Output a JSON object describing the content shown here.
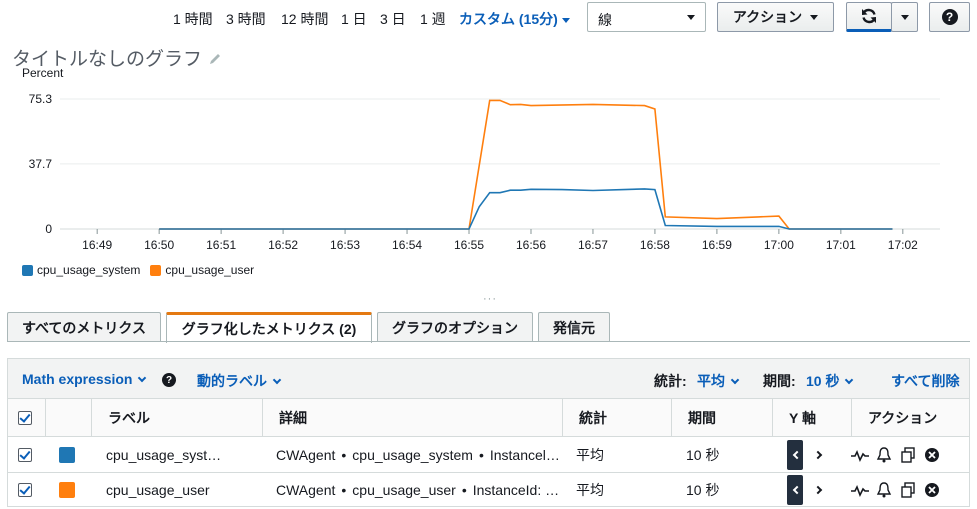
{
  "time_ranges": [
    "1 時間",
    "3 時間",
    "12 時間",
    "1 日",
    "3 日",
    "1 週"
  ],
  "custom_range": "カスタム (15分)",
  "view_select": {
    "value": "線"
  },
  "buttons": {
    "actions": "アクション"
  },
  "chart": {
    "title": "タイトルなしのグラフ",
    "unit_label": "Percent"
  },
  "chart_data": {
    "type": "line",
    "ylabel": "Percent",
    "yticks": [
      0,
      37.7,
      75.3
    ],
    "ylim": [
      0,
      75.3
    ],
    "xticks": [
      "16:49",
      "16:50",
      "16:51",
      "16:52",
      "16:53",
      "16:54",
      "16:55",
      "16:56",
      "16:57",
      "16:58",
      "16:59",
      "17:00",
      "17:01",
      "17:02"
    ],
    "grid": true,
    "legend_position": "bottom-left",
    "series": [
      {
        "name": "cpu_usage_system",
        "color": "#1f77b4",
        "points": [
          [
            "16:50",
            0
          ],
          [
            "16:55",
            0
          ],
          [
            "16:55:10",
            13
          ],
          [
            "16:55:20",
            21
          ],
          [
            "16:55:30",
            21
          ],
          [
            "16:55:40",
            22.5
          ],
          [
            "16:55:50",
            22.5
          ],
          [
            "16:56",
            23
          ],
          [
            "16:56:30",
            22.8
          ],
          [
            "16:57",
            22.3
          ],
          [
            "16:57:30",
            22.8
          ],
          [
            "16:57:50",
            23.2
          ],
          [
            "16:58",
            22.8
          ],
          [
            "16:58:10",
            2
          ],
          [
            "16:59",
            1.5
          ],
          [
            "16:59:40",
            1.5
          ],
          [
            "17:00",
            1.5
          ],
          [
            "17:00:10",
            0
          ],
          [
            "17:01:50",
            0
          ]
        ]
      },
      {
        "name": "cpu_usage_user",
        "color": "#ff7f0e",
        "points": [
          [
            "16:50",
            0
          ],
          [
            "16:55",
            0
          ],
          [
            "16:55:20",
            74.5
          ],
          [
            "16:55:30",
            74.5
          ],
          [
            "16:55:40",
            72
          ],
          [
            "16:55:50",
            72.2
          ],
          [
            "16:56",
            71.5
          ],
          [
            "16:57",
            72.2
          ],
          [
            "16:57:50",
            71.5
          ],
          [
            "16:58",
            69.5
          ],
          [
            "16:58:10",
            7
          ],
          [
            "16:59",
            6
          ],
          [
            "16:59:40",
            7
          ],
          [
            "17:00",
            7.5
          ],
          [
            "17:00:10",
            0
          ],
          [
            "17:01:50",
            0
          ]
        ]
      }
    ]
  },
  "dots": "···",
  "tabs": [
    {
      "label": "すべてのメトリクス",
      "active": false
    },
    {
      "label": "グラフ化したメトリクス (2)",
      "active": true
    },
    {
      "label": "グラフのオプション",
      "active": false
    },
    {
      "label": "発信元",
      "active": false
    }
  ],
  "toolbar": {
    "math_expression": "Math expression",
    "dynamic_labels": "動的ラベル",
    "stat_label": "統計:",
    "stat_value": "平均",
    "period_label": "期間:",
    "period_value": "10 秒",
    "delete_all": "すべて削除"
  },
  "table": {
    "headers": [
      "ラベル",
      "詳細",
      "統計",
      "期間",
      "Y 軸",
      "アクション"
    ],
    "rows": [
      {
        "color": "#1f77b4",
        "label": "cpu_usage_syst…",
        "detail_ns": "CWAgent",
        "detail_metric": "cpu_usage_system",
        "detail_dim": "Instancel…",
        "stat": "平均",
        "period": "10 秒"
      },
      {
        "color": "#ff7f0e",
        "label": "cpu_usage_user",
        "detail_ns": "CWAgent",
        "detail_metric": "cpu_usage_user",
        "detail_dim": "InstanceId: …",
        "stat": "平均",
        "period": "10 秒"
      }
    ]
  }
}
